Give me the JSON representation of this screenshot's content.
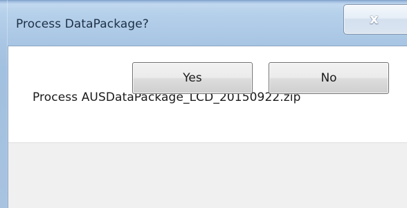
{
  "window": {
    "title": "Process DataPackage?",
    "close_glyph": "x"
  },
  "message": {
    "text": "Process AUSDataPackage_LCD_20150922.zip"
  },
  "buttons": {
    "yes_label": "Yes",
    "no_label": "No"
  },
  "icons": {
    "close": "close-icon"
  },
  "colors": {
    "titlebar": "#b5d0ea",
    "button_area": "#f0f0f0",
    "client_bg": "#ffffff"
  }
}
